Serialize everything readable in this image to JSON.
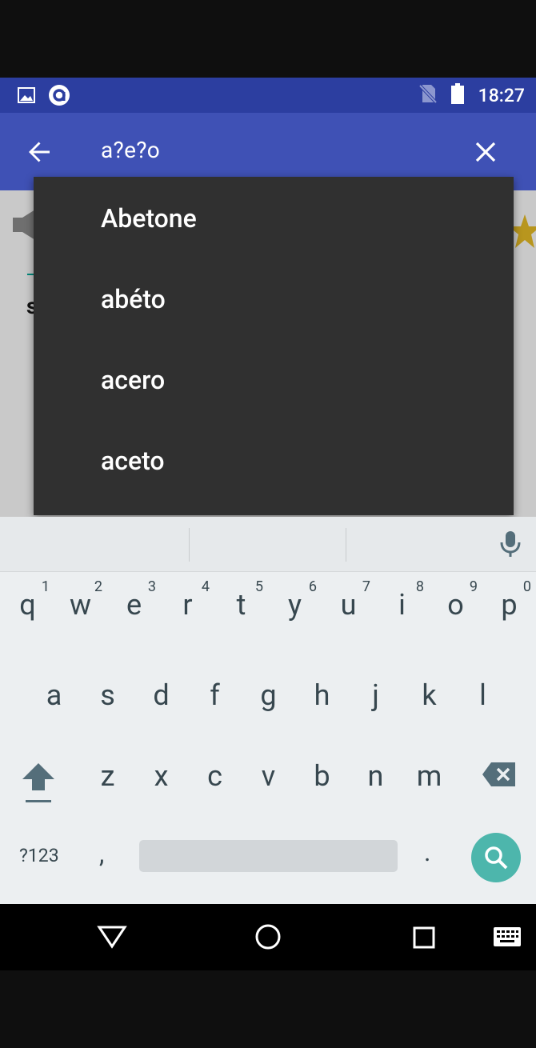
{
  "status_bar": {
    "time": "18:27",
    "icons": [
      "image-icon",
      "app-notification-icon",
      "no-sim-icon",
      "battery-icon"
    ]
  },
  "app_bar": {
    "search_query": "a?e?o",
    "back_icon": "arrow-back-icon",
    "clear_icon": "close-icon"
  },
  "background": {
    "letter": "s"
  },
  "suggestions": [
    "Abetone",
    "abéto",
    "acero",
    "aceto"
  ],
  "keyboard": {
    "row1": [
      {
        "ch": "q",
        "num": "1"
      },
      {
        "ch": "w",
        "num": "2"
      },
      {
        "ch": "e",
        "num": "3"
      },
      {
        "ch": "r",
        "num": "4"
      },
      {
        "ch": "t",
        "num": "5"
      },
      {
        "ch": "y",
        "num": "6"
      },
      {
        "ch": "u",
        "num": "7"
      },
      {
        "ch": "i",
        "num": "8"
      },
      {
        "ch": "o",
        "num": "9"
      },
      {
        "ch": "p",
        "num": "0"
      }
    ],
    "row2": [
      "a",
      "s",
      "d",
      "f",
      "g",
      "h",
      "j",
      "k",
      "l"
    ],
    "row3": [
      "z",
      "x",
      "c",
      "v",
      "b",
      "n",
      "m"
    ],
    "symbols_label": "?123",
    "comma": ",",
    "period": ".",
    "accent_color": "#4db6ac"
  },
  "nav_bar": {
    "icons": [
      "nav-back-icon",
      "nav-home-icon",
      "nav-recents-icon",
      "keyboard-switch-icon"
    ]
  },
  "colors": {
    "status_bar": "#2c3ea0",
    "app_bar": "#3f51b5",
    "dropdown": "#303030"
  }
}
